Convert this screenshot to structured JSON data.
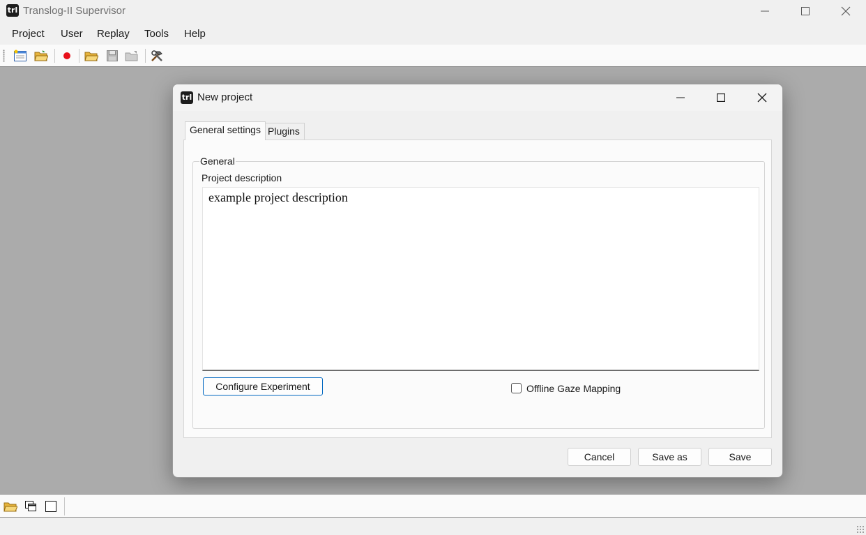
{
  "app": {
    "title": "Translog-II Supervisor",
    "icon_text": "trl"
  },
  "menu": {
    "items": [
      "Project",
      "User",
      "Replay",
      "Tools",
      "Help"
    ]
  },
  "toolbar": {
    "icons": [
      "new-project-icon",
      "open-project-icon",
      "record-icon",
      "open-folder-icon",
      "save-icon",
      "folder-gray-icon",
      "tools-icon"
    ]
  },
  "dialog": {
    "title": "New project",
    "tabs": [
      "General settings",
      "Plugins"
    ],
    "active_tab": "General settings",
    "group_title": "General",
    "description_label": "Project description",
    "description_value": "example project description",
    "configure_button": "Configure Experiment",
    "offline_gaze_label": "Offline Gaze Mapping",
    "offline_gaze_checked": false,
    "cancel_button": "Cancel",
    "save_as_button": "Save as",
    "save_button": "Save"
  },
  "bottom_toolbar": {
    "icons": [
      "open-folder-icon",
      "cascade-windows-icon",
      "maximize-window-icon"
    ]
  },
  "colors": {
    "workspace": "#ababab",
    "accent_border": "#0067c0",
    "record_red": "#e8101a"
  }
}
